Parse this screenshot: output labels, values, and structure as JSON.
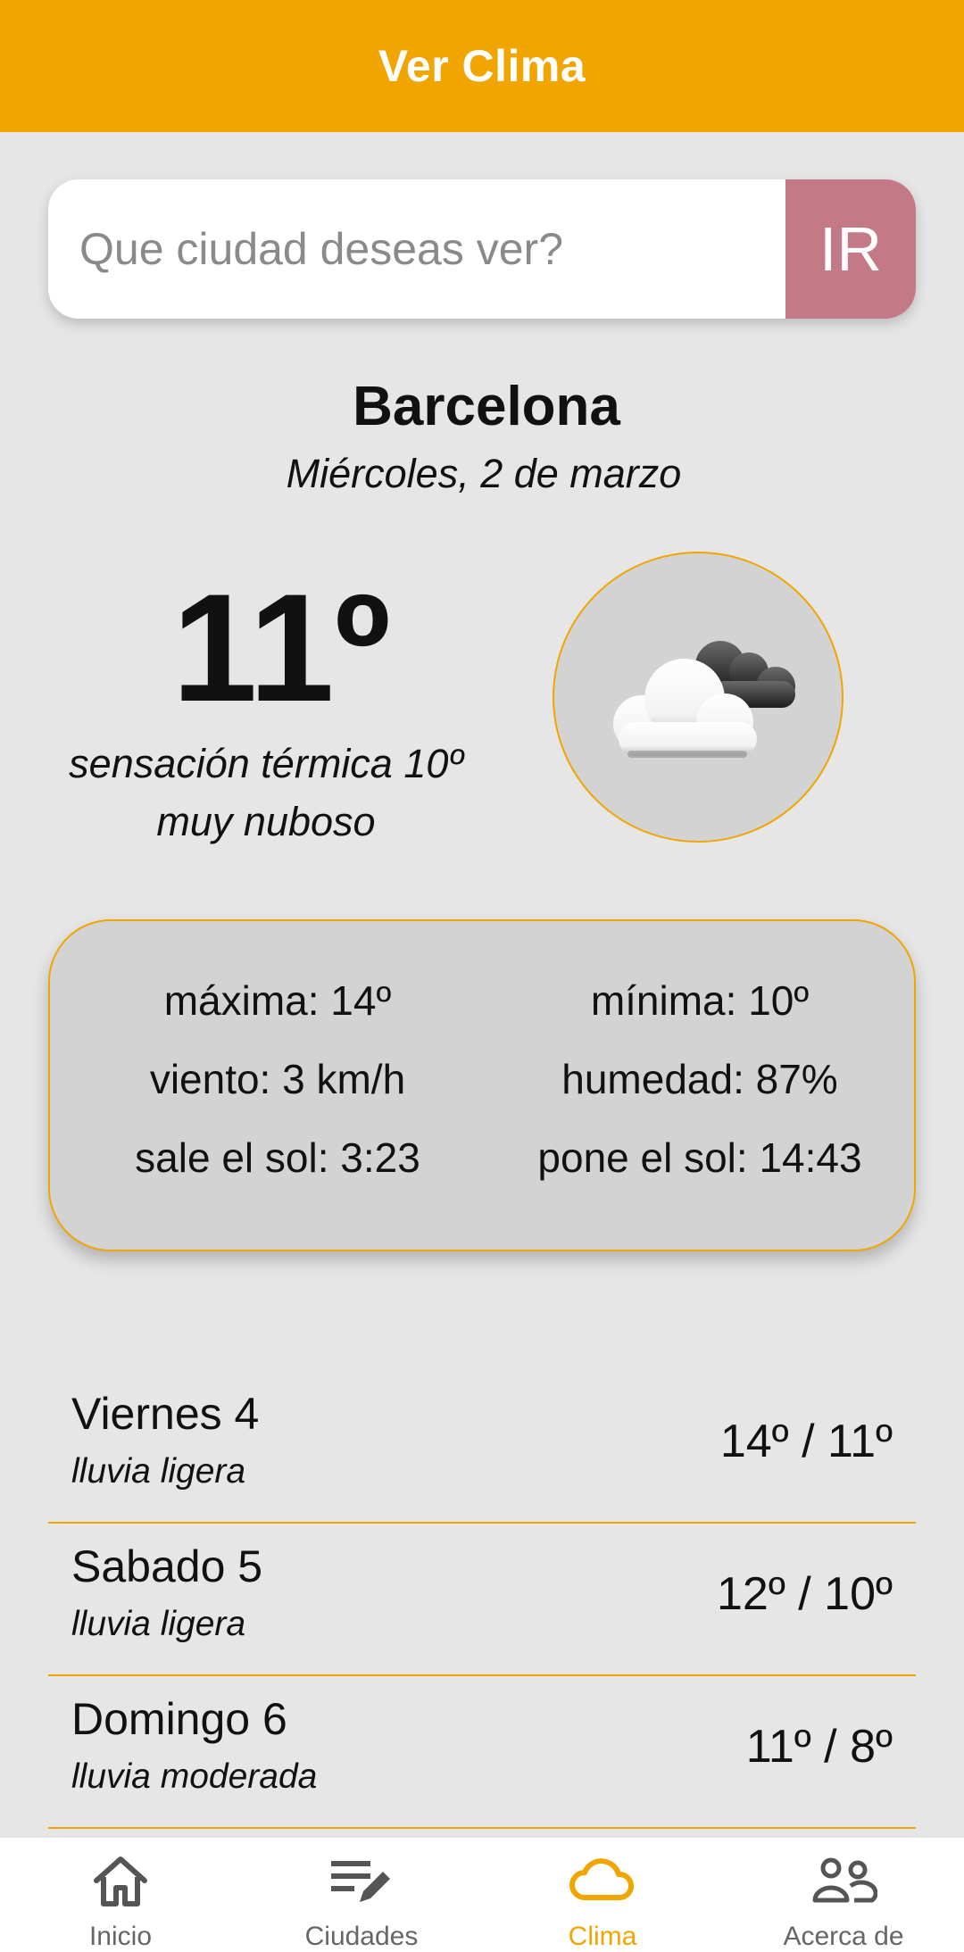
{
  "header": {
    "title": "Ver Clima"
  },
  "search": {
    "placeholder": "Que ciudad deseas ver?",
    "button_label": "IR"
  },
  "current": {
    "city": "Barcelona",
    "date": "Miércoles, 2 de marzo",
    "temperature": "11º",
    "feels_like": "sensación térmica 10º",
    "description": "muy nuboso",
    "icon": "cloudy-icon"
  },
  "details": {
    "max": "máxima: 14º",
    "min": "mínima: 10º",
    "wind": "viento: 3 km/h",
    "humidity": "humedad: 87%",
    "sunrise": "sale el sol: 3:23",
    "sunset": "pone el sol: 14:43"
  },
  "forecast": [
    {
      "day": "Viernes 4",
      "desc": "lluvia ligera",
      "temps": "14º / 11º"
    },
    {
      "day": "Sabado 5",
      "desc": "lluvia ligera",
      "temps": "12º / 10º"
    },
    {
      "day": "Domingo 6",
      "desc": "lluvia moderada",
      "temps": "11º / 8º"
    }
  ],
  "nav": {
    "items": [
      {
        "label": "Inicio",
        "icon": "home-icon"
      },
      {
        "label": "Ciudades",
        "icon": "list-edit-icon"
      },
      {
        "label": "Clima",
        "icon": "cloud-icon"
      },
      {
        "label": "Acerca de",
        "icon": "people-icon"
      }
    ],
    "active": "Clima"
  },
  "colors": {
    "accent": "#f0a500",
    "button": "#c47a86",
    "background": "#e6e6e6"
  }
}
